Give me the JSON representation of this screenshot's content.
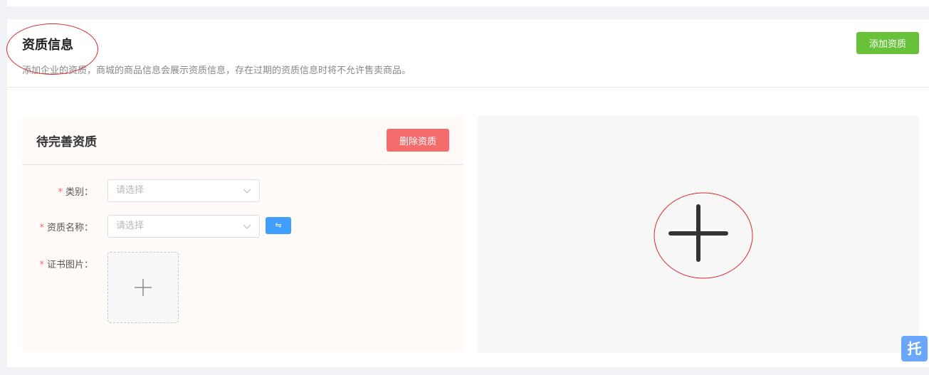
{
  "section": {
    "title": "资质信息",
    "description": "添加企业的资质，商城的商品信息会展示资质信息，存在过期的资质信息时将不允许售卖商品。",
    "add_button": "添加资质"
  },
  "panel": {
    "title": "待完善资质",
    "delete_button": "删除资质",
    "fields": {
      "category": {
        "required_mark": "*",
        "label": "类别：",
        "placeholder": "请选择"
      },
      "name": {
        "required_mark": "*",
        "label": "资质名称：",
        "placeholder": "请选择"
      },
      "image": {
        "required_mark": "*",
        "label": "证书图片："
      }
    },
    "swap_button": "⇋"
  },
  "floating_widget": {
    "label": "托"
  },
  "colors": {
    "primary": "#409eff",
    "success": "#67c23a",
    "danger": "#f56c6c",
    "annotation": "#d9262c"
  }
}
